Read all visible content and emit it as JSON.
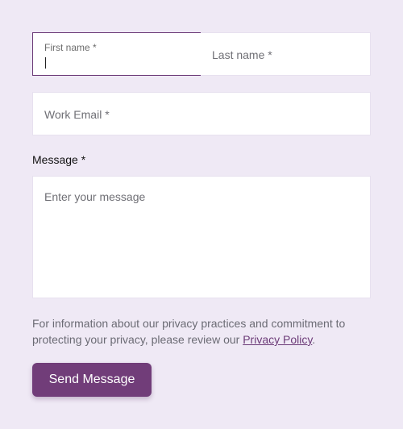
{
  "form": {
    "first_name": {
      "label": "First name *",
      "value": ""
    },
    "last_name": {
      "placeholder": "Last name *"
    },
    "work_email": {
      "placeholder": "Work Email *"
    },
    "message": {
      "label": "Message *",
      "placeholder": "Enter your message"
    },
    "privacy_notice": {
      "prefix": "For information about our privacy practices and commitment to protecting your privacy, please review our ",
      "link_text": "Privacy Policy",
      "suffix": "."
    },
    "submit_label": "Send Message"
  },
  "colors": {
    "background": "#efe9f5",
    "accent": "#713d79",
    "focus_border": "#6c3b78",
    "field_bg": "#ffffff"
  }
}
